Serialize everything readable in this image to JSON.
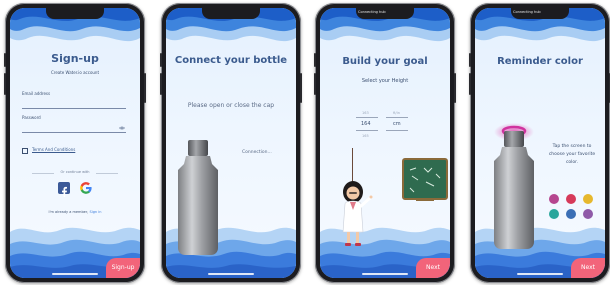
{
  "screens": [
    {
      "title": "Sign-up",
      "subtitle": "Create Water.io account",
      "email_label": "Email address",
      "password_label": "Password",
      "terms_label": "Terms And Conditions",
      "or_continue": "Or continue with",
      "member_text": "I'm already a member,",
      "signin_link": "Sign in",
      "button": "Sign-up"
    },
    {
      "title": "Connect your bottle",
      "instruction": "Please open or close the cap",
      "status": "Connection..."
    },
    {
      "top_status": "Connecting hub",
      "title": "Build your goal",
      "subtitle": "Select your Height",
      "height_prev": "163",
      "height_value": "164",
      "height_next": "165",
      "unit_prev": "ft/in",
      "unit_value": "cm",
      "button": "Next"
    },
    {
      "top_status": "Connecting hub",
      "title": "Reminder color",
      "instruction": "Tap the screen to choose your favorite color.",
      "colors": [
        "#b5468f",
        "#d63a5a",
        "#e6b82e",
        "#2aa69c",
        "#3b6fb5",
        "#8f5aa8"
      ],
      "button": "Next"
    }
  ]
}
